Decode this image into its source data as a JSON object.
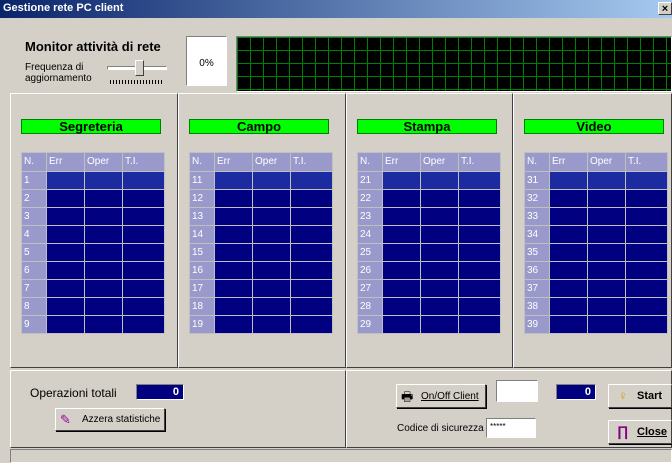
{
  "window": {
    "title": "Gestione rete PC client",
    "close_glyph": "×"
  },
  "monitor": {
    "title": "Monitor attività di rete",
    "frequency_label": "Frequenza di aggiornamento",
    "percent": "0%",
    "slider_level": 0.55
  },
  "groups": [
    {
      "name": "Segreteria",
      "start": 1
    },
    {
      "name": "Campo",
      "start": 11
    },
    {
      "name": "Stampa",
      "start": 21
    },
    {
      "name": "Video",
      "start": 31
    }
  ],
  "grid_headers": [
    "N.",
    "Err",
    "Oper",
    "T.I."
  ],
  "bottom": {
    "total_ops_label": "Operazioni totali",
    "total_ops_value": "0",
    "reset_button": "Azzera statistiche",
    "onoff_button": "On/Off Client",
    "client_field_value": "",
    "client_count": "0",
    "start_button": "Start",
    "security_code_label": "Codice di sicurezza",
    "security_code_value": "*****",
    "close_button": "Close"
  },
  "icons": {
    "reset": "broom-icon",
    "onoff": "computer-icon",
    "start": "lightbulb-icon",
    "close": "door-exit-icon"
  },
  "colors": {
    "titlebar_start": "#0a246a",
    "group_label_bg": "#00ff00",
    "grid_bg": "#000080",
    "graph_bg": "#000000",
    "graph_grid": "#008000"
  }
}
